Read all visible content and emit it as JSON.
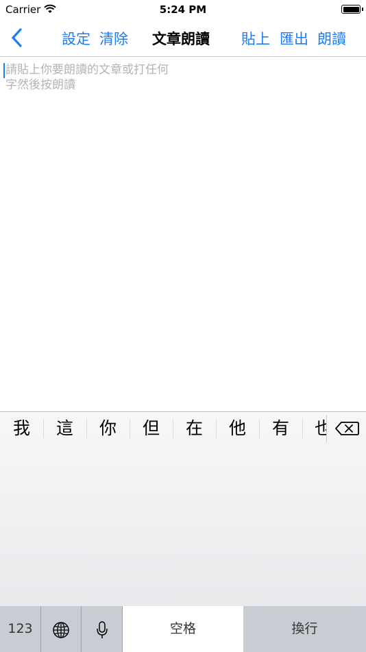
{
  "status_bar": {
    "carrier": "Carrier",
    "time": "5:24 PM",
    "battery_level": 1.0
  },
  "nav": {
    "back_icon": "chevron-left-icon",
    "settings": "設定",
    "clear": "清除",
    "title": "文章朗讀",
    "paste": "貼上",
    "export": "匯出",
    "read": "朗讀",
    "accent_color": "#1e7cf5"
  },
  "editor": {
    "placeholder_line1": "請貼上你要朗讀的文章或打任何",
    "placeholder_line2": "字然後按朗讀"
  },
  "keyboard": {
    "candidates": [
      "我",
      "這",
      "你",
      "但",
      "在",
      "他",
      "有",
      "也"
    ],
    "backspace_icon": "backspace-icon",
    "key_123": "123",
    "globe_icon": "globe-icon",
    "mic_icon": "microphone-icon",
    "space": "空格",
    "return": "換行"
  }
}
